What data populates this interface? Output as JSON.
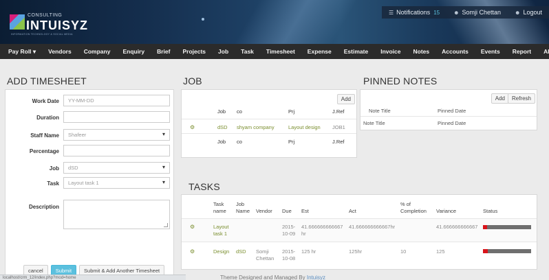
{
  "header": {
    "logo_subtitle": "CONSULTING",
    "logo_title": "INTUISYZ",
    "logo_tagline": "INFORMATION TECHNOLOGY & SOCIAL MEDIA",
    "notifications_label": "Notifications",
    "notifications_count": "15",
    "user_name": "Somji Chettan",
    "logout_label": "Logout"
  },
  "nav": {
    "items": [
      "Pay Roll ▾",
      "Vendors",
      "Company",
      "Enquiry",
      "Brief",
      "Projects",
      "Job",
      "Task",
      "Timesheet",
      "Expense",
      "Estimate",
      "Invoice",
      "Notes",
      "Accounts",
      "Events"
    ],
    "right_items": [
      "Report",
      "ADMIN"
    ]
  },
  "timesheet": {
    "title": "ADD TIMESHEET",
    "fields": {
      "work_date_label": "Work Date",
      "work_date_placeholder": "YY-MM-DD",
      "duration_label": "Duration",
      "staff_label": "Staff Name",
      "staff_value": "Shafeer",
      "percentage_label": "Percentage",
      "job_label": "Job",
      "job_value": "dSD",
      "task_label": "Task",
      "task_value": "Layout task 1",
      "description_label": "Description"
    },
    "buttons": {
      "cancel": "cancel",
      "submit": "Submit",
      "submit_add": "Submit & Add Another Timesheet"
    }
  },
  "job": {
    "title": "JOB",
    "add_label": "Add",
    "columns": [
      "Job",
      "co",
      "Prj",
      "J.Ref"
    ],
    "rows": [
      {
        "job": "dSD",
        "co": "shyam company",
        "prj": "Layout design",
        "ref": "JOB1"
      }
    ]
  },
  "pinned_notes": {
    "title": "PINNED NOTES",
    "add_label": "Add",
    "refresh_label": "Refresh",
    "columns": [
      "Note Title",
      "Pinned Date"
    ]
  },
  "tasks": {
    "title": "TASKS",
    "columns": {
      "task_name": "Task name",
      "job_name": "Job Name",
      "vendor": "Vendor",
      "due": "Due",
      "est": "Est",
      "act": "Act",
      "completion": "% of Completion",
      "variance": "Variance",
      "status": "Status"
    },
    "rows": [
      {
        "task": "Layout task 1",
        "job": "",
        "vendor": "",
        "due": "2015-10-09",
        "est": "41.666666666667 hr",
        "act": "41.666666666667hr",
        "completion": "",
        "variance": "41.666666666667",
        "status_fill": 0.08
      },
      {
        "task": "Design",
        "job": "dSD",
        "vendor": "Somji Chettan",
        "due": "2015-10-08",
        "est": "125 hr",
        "act": "125hr",
        "completion": "10",
        "variance": "125",
        "status_fill": 0.1
      }
    ]
  },
  "footer": {
    "text": "Theme Designed and Managed By",
    "brand": "Intuisyz",
    "status_url": "localhost/crm_12/index.php?mod=home"
  },
  "colors": {
    "accent_link": "#7a8e2e",
    "nav_bg": "#2b2b2b",
    "status_red": "#d9141b",
    "primary_button": "#5bc0de"
  }
}
